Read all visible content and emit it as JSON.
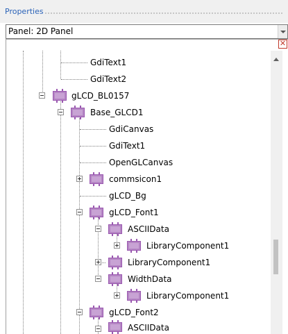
{
  "panel": {
    "title": "Properties",
    "selector_value": "Panel: 2D Panel",
    "close_glyph": "✕"
  },
  "tree": {
    "nodes": {
      "gditext1_top": "GdiText1",
      "gditext2_top": "GdiText2",
      "glcd_bl0157": "gLCD_BL0157",
      "base_glcd1": "Base_GLCD1",
      "gdicanvas": "GdiCanvas",
      "gditext1": "GdiText1",
      "openglcanvas": "OpenGLCanvas",
      "commsicon1": "commsicon1",
      "glcd_bg": "gLCD_Bg",
      "glcd_font1": "gLCD_Font1",
      "asciidata_1": "ASCIIData",
      "librarycomponent1_a": "LibraryComponent1",
      "librarycomponent1_b": "LibraryComponent1",
      "widthdata": "WidthData",
      "librarycomponent1_c": "LibraryComponent1",
      "glcd_font2": "gLCD_Font2",
      "asciidata_2": "ASCIIData"
    }
  },
  "icons": {
    "component": "component-icon",
    "expand": "plus-icon",
    "collapse": "minus-icon",
    "close": "close-icon",
    "scroll_up": "scroll-up-arrow-icon",
    "dropdown": "chevron-down-icon"
  },
  "colors": {
    "header_title": "#2b63b8",
    "component_fill": "#b586c4",
    "component_border": "#9a58b0",
    "close_red": "#c0392b",
    "tree_lines": "#808080"
  }
}
